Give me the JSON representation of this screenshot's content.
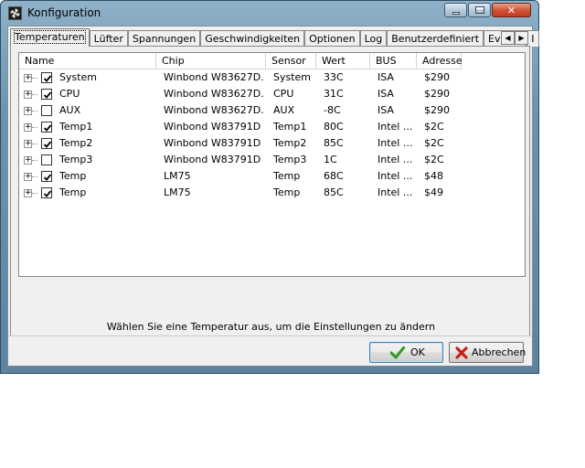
{
  "window": {
    "title": "Konfiguration"
  },
  "tabs": [
    "Temperaturen",
    "Lüfter",
    "Spannungen",
    "Geschwindigkeiten",
    "Optionen",
    "Log",
    "Benutzerdefiniert",
    "Events",
    "I"
  ],
  "table": {
    "columns": [
      "Name",
      "Chip",
      "Sensor",
      "Wert",
      "BUS",
      "Adresse"
    ],
    "rows": [
      {
        "checked": true,
        "name": "System",
        "chip": "Winbond W83627D...",
        "sensor": "System",
        "wert": "33C",
        "bus": "ISA",
        "adresse": "$290"
      },
      {
        "checked": true,
        "name": "CPU",
        "chip": "Winbond W83627D...",
        "sensor": "CPU",
        "wert": "31C",
        "bus": "ISA",
        "adresse": "$290"
      },
      {
        "checked": false,
        "name": "AUX",
        "chip": "Winbond W83627D...",
        "sensor": "AUX",
        "wert": "-8C",
        "bus": "ISA",
        "adresse": "$290"
      },
      {
        "checked": true,
        "name": "Temp1",
        "chip": "Winbond W83791D",
        "sensor": "Temp1",
        "wert": "80C",
        "bus": "Intel ...",
        "adresse": "$2C"
      },
      {
        "checked": true,
        "name": "Temp2",
        "chip": "Winbond W83791D",
        "sensor": "Temp2",
        "wert": "85C",
        "bus": "Intel ...",
        "adresse": "$2C"
      },
      {
        "checked": false,
        "name": "Temp3",
        "chip": "Winbond W83791D",
        "sensor": "Temp3",
        "wert": "1C",
        "bus": "Intel ...",
        "adresse": "$2C"
      },
      {
        "checked": true,
        "name": "Temp",
        "chip": "LM75",
        "sensor": "Temp",
        "wert": "68C",
        "bus": "Intel ...",
        "adresse": "$48"
      },
      {
        "checked": true,
        "name": "Temp",
        "chip": "LM75",
        "sensor": "Temp",
        "wert": "85C",
        "bus": "Intel ...",
        "adresse": "$49"
      }
    ]
  },
  "hint": "Wählen Sie eine Temperatur aus, um die Einstellungen zu ändern",
  "buttons": {
    "ok": "OK",
    "cancel": "Abbrechen"
  },
  "icons": {
    "ok": "green-check-icon",
    "cancel": "red-x-icon",
    "app": "fan-icon"
  },
  "colors": {
    "ok_check": "#2f9b1e",
    "cancel_x": "#c8231b"
  }
}
